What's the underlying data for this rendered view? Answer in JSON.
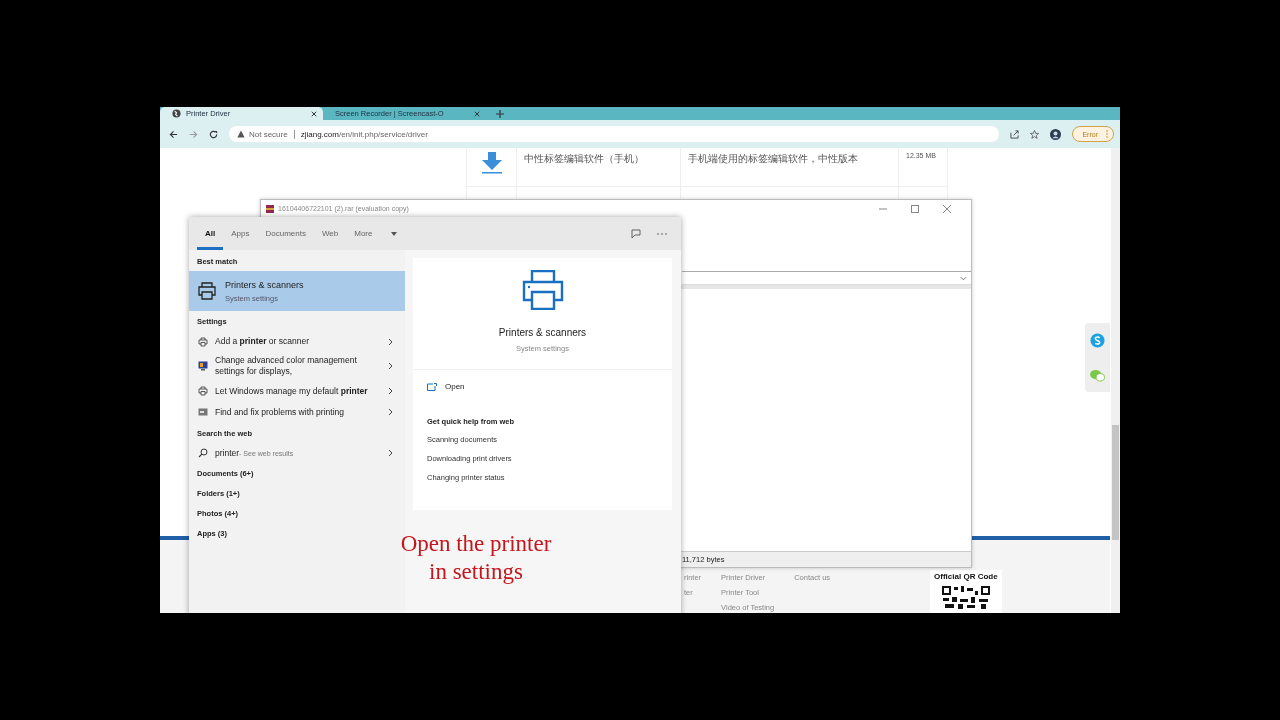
{
  "browser": {
    "tabs": [
      {
        "title": "Printer Driver",
        "selected": true
      },
      {
        "title": "Screen Recorder | Screencast-O",
        "selected": false
      }
    ],
    "security": "Not secure",
    "url_host": "zjiang.com",
    "url_path": "/en/init.php/service/driver",
    "profile_button": "Error"
  },
  "page": {
    "download_row": {
      "name": "中性标签编辑软件（手机）",
      "description": "手机端使用的标签编辑软件，中性版本",
      "size": "12.35 MB"
    },
    "footer_columns": [
      [
        "rinter",
        "ter"
      ],
      [
        "Printer Driver",
        "Printer Tool",
        "Video of Testing"
      ],
      [
        "Contact us"
      ]
    ],
    "qr_title": "Official QR Code"
  },
  "archive_window": {
    "title": "16104406722101 (2).rar (evaluation copy)",
    "status": "11,712 bytes"
  },
  "search": {
    "tabs": [
      {
        "label": "All",
        "selected": true
      },
      {
        "label": "Apps",
        "selected": false
      },
      {
        "label": "Documents",
        "selected": false
      },
      {
        "label": "Web",
        "selected": false
      },
      {
        "label": "More",
        "selected": false
      }
    ],
    "best_match_heading": "Best match",
    "best_match": {
      "title": "Printers & scanners",
      "subtitle": "System settings",
      "selected": true
    },
    "sections": [
      {
        "heading": "Settings",
        "items": [
          {
            "kind": "printer",
            "text": "Add a **printer** or scanner"
          },
          {
            "kind": "display",
            "text": "Change advanced color management settings for displays,"
          },
          {
            "kind": "printer",
            "text": "Let Windows manage my default **printer**"
          },
          {
            "kind": "troubleshoot",
            "text": "Find and fix problems with printing"
          }
        ]
      },
      {
        "heading": "Search the web",
        "items": [
          {
            "kind": "web",
            "text": "printer",
            "hint": "- See web results"
          }
        ]
      }
    ],
    "categories": [
      "Documents (6+)",
      "Folders (1+)",
      "Photos (4+)",
      "Apps (3)"
    ],
    "detail": {
      "title": "Printers & scanners",
      "subtitle": "System settings",
      "open": "Open",
      "help_heading": "Get quick help from web",
      "help_links": [
        "Scanning documents",
        "Downloading print drivers",
        "Changing printer status"
      ]
    }
  },
  "caption": [
    "Open the printer",
    "in settings"
  ]
}
